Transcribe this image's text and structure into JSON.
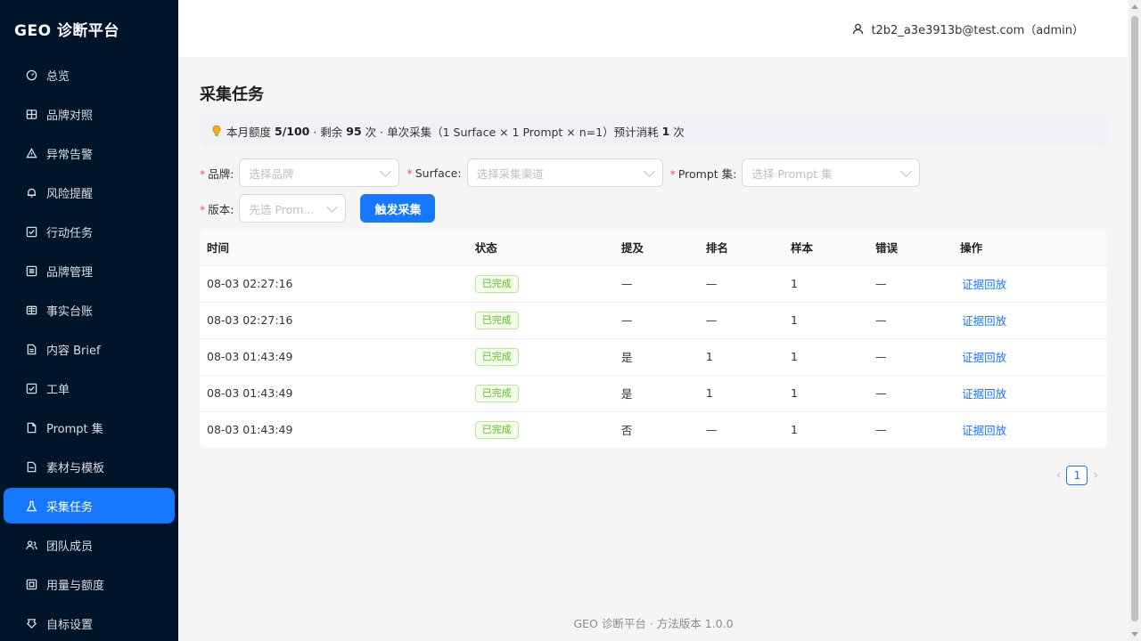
{
  "app": {
    "title": "GEO 诊断平台"
  },
  "user": {
    "label": "t2b2_a3e3913b@test.com（admin）"
  },
  "sidebar": {
    "items": [
      {
        "label": "总览",
        "icon": "dashboard-icon",
        "active": false
      },
      {
        "label": "品牌对照",
        "icon": "compare-icon",
        "active": false
      },
      {
        "label": "异常告警",
        "icon": "alert-icon",
        "active": false
      },
      {
        "label": "风险提醒",
        "icon": "bell-icon",
        "active": false
      },
      {
        "label": "行动任务",
        "icon": "task-icon",
        "active": false
      },
      {
        "label": "品牌管理",
        "icon": "brand-icon",
        "active": false
      },
      {
        "label": "事实台账",
        "icon": "ledger-icon",
        "active": false
      },
      {
        "label": "内容 Brief",
        "icon": "doc-icon",
        "active": false
      },
      {
        "label": "工单",
        "icon": "ticket-icon",
        "active": false
      },
      {
        "label": "Prompt 集",
        "icon": "file-icon",
        "active": false
      },
      {
        "label": "素材与模板",
        "icon": "template-icon",
        "active": false
      },
      {
        "label": "采集任务",
        "icon": "flask-icon",
        "active": true
      },
      {
        "label": "团队成员",
        "icon": "team-icon",
        "active": false
      },
      {
        "label": "用量与额度",
        "icon": "usage-icon",
        "active": false
      },
      {
        "label": "自标设置",
        "icon": "settings-icon",
        "active": false
      }
    ]
  },
  "page": {
    "title": "采集任务",
    "quota": {
      "icon": "lightbulb-icon",
      "prefix": "本月额度",
      "used": "5/100",
      "mid1": "· 剩余",
      "remaining": "95",
      "mid2": "次 · 单次采集（1 Surface × 1 Prompt × n=1）预计消耗",
      "cost": "1",
      "suffix": "次"
    },
    "filters": {
      "brand": {
        "label": "品牌:",
        "placeholder": "选择品牌"
      },
      "surface": {
        "label": "Surface:",
        "placeholder": "选择采集渠道"
      },
      "prompt_set": {
        "label": "Prompt 集:",
        "placeholder": "选择 Prompt 集"
      },
      "version": {
        "label": "版本:",
        "placeholder": "先选 Prom..."
      },
      "trigger_label": "触发采集"
    },
    "table": {
      "columns": [
        "时间",
        "状态",
        "提及",
        "排名",
        "样本",
        "错误",
        "操作"
      ],
      "rows": [
        {
          "time": "08-03 02:27:16",
          "status": "已完成",
          "mention": "—",
          "rank": "—",
          "sample": "1",
          "error": "—",
          "action": "证据回放"
        },
        {
          "time": "08-03 02:27:16",
          "status": "已完成",
          "mention": "—",
          "rank": "—",
          "sample": "1",
          "error": "—",
          "action": "证据回放"
        },
        {
          "time": "08-03 01:43:49",
          "status": "已完成",
          "mention": "是",
          "rank": "1",
          "sample": "1",
          "error": "—",
          "action": "证据回放"
        },
        {
          "time": "08-03 01:43:49",
          "status": "已完成",
          "mention": "是",
          "rank": "1",
          "sample": "1",
          "error": "—",
          "action": "证据回放"
        },
        {
          "time": "08-03 01:43:49",
          "status": "已完成",
          "mention": "否",
          "rank": "—",
          "sample": "1",
          "error": "—",
          "action": "证据回放"
        }
      ]
    },
    "pagination": {
      "current": "1",
      "prev": "‹",
      "next": "›"
    }
  },
  "footer": {
    "text": "GEO 诊断平台 · 方法版本 1.0.0"
  },
  "colors": {
    "primary": "#1677ff",
    "sidebar_bg": "#001529",
    "success": "#52c41a"
  }
}
